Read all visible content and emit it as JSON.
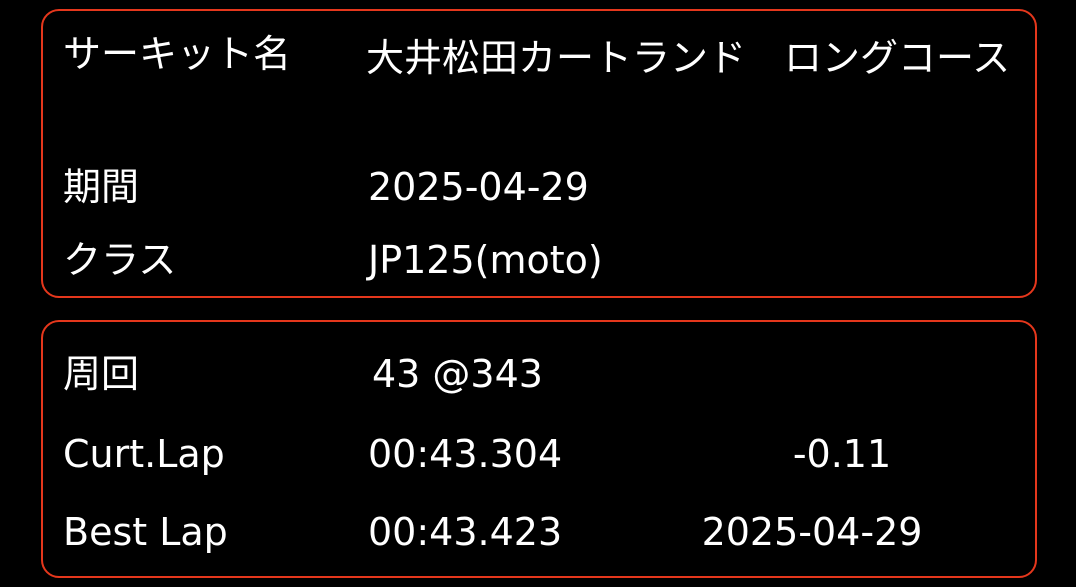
{
  "info": {
    "circuit_label": "サーキット名",
    "circuit_value": "大井松田カートランド　ロングコース",
    "period_label": "期間",
    "period_value": "2025-04-29",
    "class_label": "クラス",
    "class_value": "JP125(moto)"
  },
  "laps": {
    "lap_count_label": "周回",
    "lap_count_value": "43 @343",
    "current_label": "Curt.Lap",
    "current_time": "00:43.304",
    "current_diff": "-0.11",
    "best_label": "Best Lap",
    "best_time": "00:43.423",
    "best_date": "2025-04-29"
  },
  "colors": {
    "background": "#000000",
    "border": "#e5371c",
    "text": "#ffffff"
  }
}
